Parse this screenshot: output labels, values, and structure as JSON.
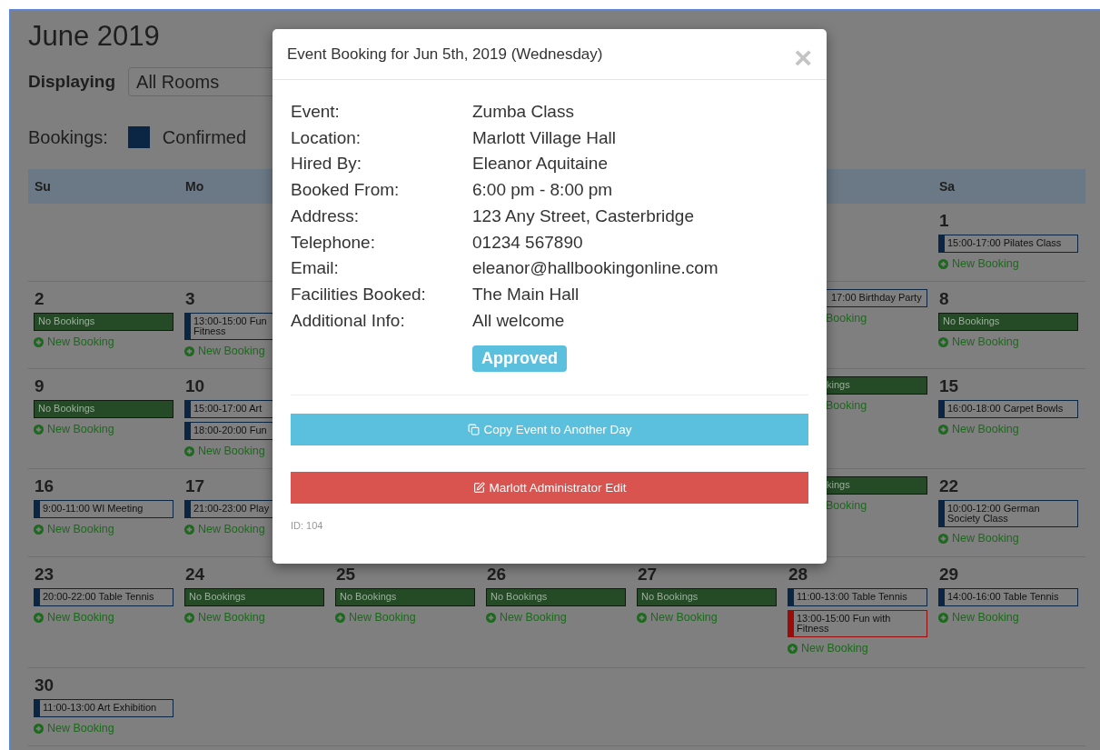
{
  "page": {
    "title": "June 2019",
    "filter_label": "Displaying",
    "room_select": {
      "value": "All Rooms"
    },
    "legend": {
      "label": "Bookings:",
      "items": [
        {
          "label": "Confirmed",
          "color": "#0b2545"
        }
      ]
    }
  },
  "calendar": {
    "day_headers": [
      {
        "kind": "day",
        "label": "Su"
      },
      {
        "kind": "day",
        "label": "Mo"
      },
      {
        "kind": "blank"
      },
      {
        "kind": "blank"
      },
      {
        "kind": "blank"
      },
      {
        "kind": "blank"
      },
      {
        "kind": "day",
        "label": "Sa"
      }
    ],
    "weeks": [
      {
        "days": [
          {
            "kind": "blank"
          },
          {
            "kind": "blank"
          },
          {
            "kind": "blank"
          },
          {
            "kind": "blank"
          },
          {
            "kind": "blank"
          },
          {
            "kind": "blank"
          },
          {
            "kind": "day",
            "date": "1",
            "entries": [
              {
                "kind": "booking",
                "color": "#0b2545",
                "text": "15:00-17:00 Pilates Class"
              }
            ],
            "new_booking": "New Booking"
          }
        ]
      },
      {
        "days": [
          {
            "kind": "day",
            "date": "2",
            "entries": [
              {
                "kind": "none",
                "text": "No Bookings"
              }
            ],
            "new_booking": "New Booking"
          },
          {
            "kind": "day",
            "date": "3",
            "entries": [
              {
                "kind": "booking",
                "color": "#0b2545",
                "text": "13:00-15:00 Fun\nFitness"
              }
            ],
            "new_booking": "New Booking"
          },
          {
            "kind": "blank"
          },
          {
            "kind": "blank"
          },
          {
            "kind": "blank"
          },
          {
            "kind": "partial",
            "entries": [
              {
                "kind": "booking",
                "color": "#0b2545",
                "text": "17:00 Birthday Party"
              }
            ],
            "new_booking": "Booking"
          },
          {
            "kind": "day",
            "date": "8",
            "entries": [
              {
                "kind": "none",
                "text": "No Bookings"
              }
            ],
            "new_booking": "New Booking"
          }
        ]
      },
      {
        "days": [
          {
            "kind": "day",
            "date": "9",
            "entries": [
              {
                "kind": "none",
                "text": "No Bookings"
              }
            ],
            "new_booking": "New Booking"
          },
          {
            "kind": "day",
            "date": "10",
            "entries": [
              {
                "kind": "booking",
                "color": "#0b2545",
                "text": "15:00-17:00 Art"
              },
              {
                "kind": "booking",
                "color": "#0b2545",
                "text": "18:00-20:00 Fun"
              }
            ],
            "new_booking": "New Booking"
          },
          {
            "kind": "blank"
          },
          {
            "kind": "blank"
          },
          {
            "kind": "blank"
          },
          {
            "kind": "partial",
            "entries": [
              {
                "kind": "none",
                "text": "kings"
              }
            ],
            "new_booking": "Booking"
          },
          {
            "kind": "day",
            "date": "15",
            "entries": [
              {
                "kind": "booking",
                "color": "#0b2545",
                "text": "16:00-18:00 Carpet Bowls"
              }
            ],
            "new_booking": "New Booking"
          }
        ]
      },
      {
        "days": [
          {
            "kind": "day",
            "date": "16",
            "entries": [
              {
                "kind": "booking",
                "color": "#0b2545",
                "text": "9:00-11:00 WI Meeting"
              }
            ],
            "new_booking": "New Booking"
          },
          {
            "kind": "day",
            "date": "17",
            "entries": [
              {
                "kind": "booking",
                "color": "#0b2545",
                "text": "21:00-23:00 Play"
              }
            ],
            "new_booking": "New Booking"
          },
          {
            "kind": "blank"
          },
          {
            "kind": "blank"
          },
          {
            "kind": "blank"
          },
          {
            "kind": "partial",
            "entries": [
              {
                "kind": "none",
                "text": "kings"
              }
            ],
            "new_booking": "Booking"
          },
          {
            "kind": "day",
            "date": "22",
            "entries": [
              {
                "kind": "booking",
                "color": "#0b2545",
                "text": "10:00-12:00 German Society Class"
              }
            ],
            "new_booking": "New Booking"
          }
        ]
      },
      {
        "days": [
          {
            "kind": "day",
            "date": "23",
            "entries": [
              {
                "kind": "booking",
                "color": "#0b2545",
                "text": "20:00-22:00 Table Tennis"
              }
            ],
            "new_booking": "New Booking"
          },
          {
            "kind": "day",
            "date": "24",
            "entries": [
              {
                "kind": "none",
                "text": "No Bookings"
              }
            ],
            "new_booking": "New Booking"
          },
          {
            "kind": "day",
            "date": "25",
            "entries": [
              {
                "kind": "none",
                "text": "No Bookings"
              }
            ],
            "new_booking": "New Booking"
          },
          {
            "kind": "day",
            "date": "26",
            "entries": [
              {
                "kind": "none",
                "text": "No Bookings"
              }
            ],
            "new_booking": "New Booking"
          },
          {
            "kind": "day",
            "date": "27",
            "entries": [
              {
                "kind": "none",
                "text": "No Bookings"
              }
            ],
            "new_booking": "New Booking"
          },
          {
            "kind": "day",
            "date": "28",
            "entries": [
              {
                "kind": "booking",
                "color": "#0b2545",
                "text": "11:00-13:00 Table Tennis"
              },
              {
                "kind": "booking",
                "color": "#9a0b0b",
                "text": "13:00-15:00 Fun with Fitness"
              }
            ],
            "new_booking": "New Booking"
          },
          {
            "kind": "day",
            "date": "29",
            "entries": [
              {
                "kind": "booking",
                "color": "#0b2545",
                "text": "14:00-16:00 Table Tennis"
              }
            ],
            "new_booking": "New Booking"
          }
        ]
      },
      {
        "days": [
          {
            "kind": "day",
            "date": "30",
            "entries": [
              {
                "kind": "booking",
                "color": "#0b2545",
                "text": "11:00-13:00 Art Exhibition"
              }
            ],
            "new_booking": "New Booking"
          },
          {
            "kind": "blank"
          },
          {
            "kind": "blank"
          },
          {
            "kind": "blank"
          },
          {
            "kind": "blank"
          },
          {
            "kind": "blank"
          },
          {
            "kind": "blank"
          }
        ]
      }
    ]
  },
  "modal": {
    "title": "Event Booking for Jun 5th, 2019 (Wednesday)",
    "close": "×",
    "fields": [
      {
        "label": "Event:",
        "value": "Zumba Class"
      },
      {
        "label": "Location:",
        "value": "Marlott Village Hall"
      },
      {
        "label": "Hired By:",
        "value": "Eleanor Aquitaine"
      },
      {
        "label": "Booked From:",
        "value": "6:00 pm - 8:00 pm"
      },
      {
        "label": "Address:",
        "value": "123 Any Street, Casterbridge"
      },
      {
        "label": "Telephone:",
        "value": "01234 567890"
      },
      {
        "label": "Email:",
        "value": "eleanor@hallbookingonline.com"
      },
      {
        "label": "Facilities Booked:",
        "value": "The Main Hall"
      },
      {
        "label": "Additional Info:",
        "value": "All welcome"
      }
    ],
    "status": "Approved",
    "actions": [
      {
        "kind": "copy",
        "label": "Copy Event to Another Day"
      },
      {
        "kind": "edit",
        "label": "Marlott Administrator Edit"
      }
    ],
    "id": "ID: 104"
  }
}
